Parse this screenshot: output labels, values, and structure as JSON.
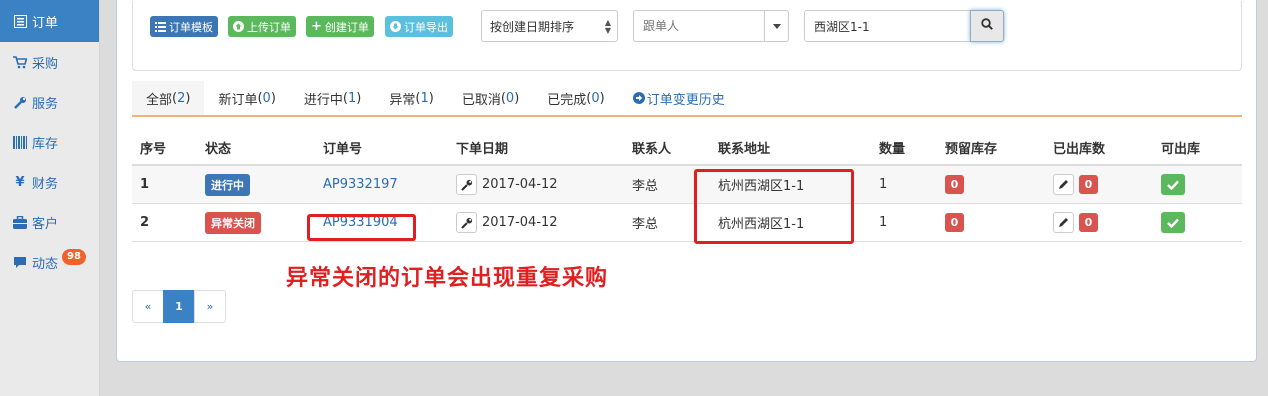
{
  "sidebar": {
    "items": [
      {
        "label": "订单",
        "icon": "list-icon"
      },
      {
        "label": "采购",
        "icon": "cart-icon"
      },
      {
        "label": "服务",
        "icon": "wrench-icon"
      },
      {
        "label": "库存",
        "icon": "barcode-icon"
      },
      {
        "label": "财务",
        "icon": "yen-icon"
      },
      {
        "label": "客户",
        "icon": "briefcase-icon"
      },
      {
        "label": "动态",
        "icon": "comment-icon",
        "badge": "98"
      }
    ],
    "active_index": 0
  },
  "toolbar": {
    "template_btn": "订单模板",
    "upload_btn": "上传订单",
    "create_btn": "创建订单",
    "export_btn": "订单导出",
    "sort_select": "按创建日期排序",
    "follower_placeholder": "跟单人",
    "search_value": "西湖区1-1"
  },
  "tabs": [
    {
      "label": "全部",
      "count": "2"
    },
    {
      "label": "新订单",
      "count": "0"
    },
    {
      "label": "进行中",
      "count": "1"
    },
    {
      "label": "异常",
      "count": "1"
    },
    {
      "label": "已取消",
      "count": "0"
    },
    {
      "label": "已完成",
      "count": "0"
    }
  ],
  "history_tab": "订单变更历史",
  "table": {
    "headers": [
      "序号",
      "状态",
      "订单号",
      "下单日期",
      "联系人",
      "联系地址",
      "数量",
      "预留库存",
      "已出库数",
      "可出库"
    ],
    "rows": [
      {
        "index": "1",
        "status": "进行中",
        "status_color": "#3c76b4",
        "order_no": "AP9332197",
        "date": "2017-04-12",
        "contact": "李总",
        "address": "杭州西湖区1-1",
        "qty": "1",
        "reserved": "0",
        "shipped": "0"
      },
      {
        "index": "2",
        "status": "异常关闭",
        "status_color": "#d9534f",
        "order_no": "AP9331904",
        "date": "2017-04-12",
        "contact": "李总",
        "address": "杭州西湖区1-1",
        "qty": "1",
        "reserved": "0",
        "shipped": "0"
      }
    ]
  },
  "annotation": {
    "text": "异常关闭的订单会出现重复采购",
    "color": "#e02020"
  },
  "pagination": {
    "prev": "«",
    "current": "1",
    "next": "»"
  }
}
